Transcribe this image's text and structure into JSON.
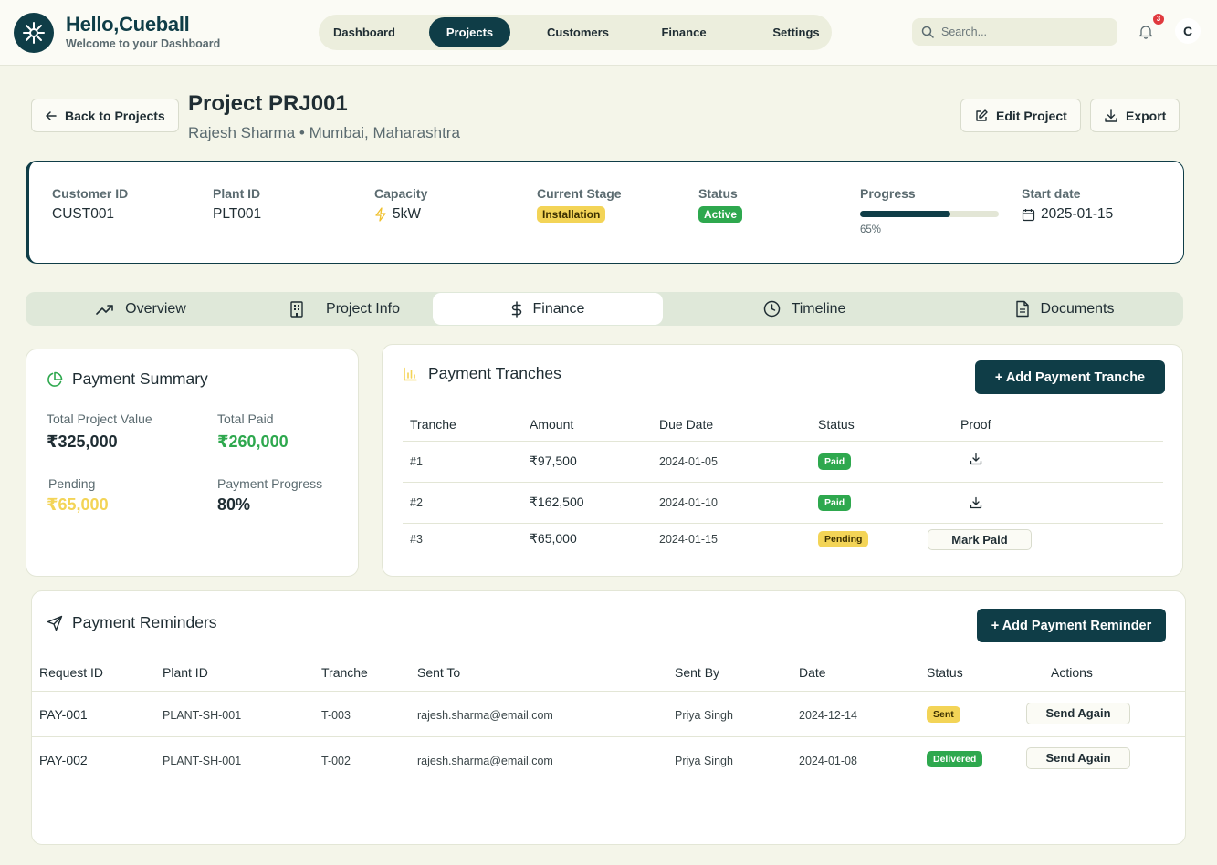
{
  "header": {
    "title": "Hello,Cueball",
    "subtitle": "Welcome to your Dashboard",
    "nav": [
      "Dashboard",
      "Projects",
      "Customers",
      "Finance",
      "Settings"
    ],
    "active_nav": "Projects",
    "search_placeholder": "Search...",
    "notification_count": "3",
    "avatar_initial": "C"
  },
  "project": {
    "back_label": "Back to Projects",
    "title": "Project PRJ001",
    "subtitle": "Rajesh Sharma • Mumbai, Maharashtra",
    "edit_label": "Edit Project",
    "export_label": "Export"
  },
  "info": {
    "customer_id_label": "Customer ID",
    "customer_id": "CUST001",
    "plant_id_label": "Plant ID",
    "plant_id": "PLT001",
    "capacity_label": "Capacity",
    "capacity": "5kW",
    "stage_label": "Current Stage",
    "stage": "Installation",
    "status_label": "Status",
    "status": "Active",
    "progress_label": "Progress",
    "progress_text": "65%",
    "progress_value": 0.65,
    "start_label": "Start date",
    "start_date": "2025-01-15"
  },
  "tabs": [
    "Overview",
    "Project Info",
    "Finance",
    "Timeline",
    "Documents"
  ],
  "active_tab": "Finance",
  "summary": {
    "title": "Payment Summary",
    "total_label": "Total Project Value",
    "total_value": "₹325,000",
    "paid_label": "Total Paid",
    "paid_value": "₹260,000",
    "pending_label": "Pending",
    "pending_value": "₹65,000",
    "progress_label": "Payment Progress",
    "progress_value": "80%"
  },
  "tranches": {
    "title": "Payment Tranches",
    "add_label": "+ Add Payment Tranche",
    "columns": [
      "Tranche",
      "Amount",
      "Due Date",
      "Status",
      "Proof"
    ],
    "rows": [
      {
        "id": "#1",
        "amount": "₹97,500",
        "due": "2024-01-05",
        "status": "Paid",
        "proof": "download"
      },
      {
        "id": "#2",
        "amount": "₹162,500",
        "due": "2024-01-10",
        "status": "Paid",
        "proof": "download"
      },
      {
        "id": "#3",
        "amount": "₹65,000",
        "due": "2024-01-15",
        "status": "Pending",
        "proof": "Mark Paid"
      }
    ]
  },
  "reminders": {
    "title": "Payment Reminders",
    "add_label": "+ Add Payment Reminder",
    "columns": [
      "Request ID",
      "Plant ID",
      "Tranche",
      "Sent To",
      "Sent By",
      "Date",
      "Status",
      "Actions"
    ],
    "rows": [
      {
        "request_id": "PAY-001",
        "plant_id": "PLANT-SH-001",
        "tranche": "T-003",
        "sent_to": "rajesh.sharma@email.com",
        "sent_by": "Priya Singh",
        "date": "2024-12-14",
        "status": "Sent",
        "action": "Send Again"
      },
      {
        "request_id": "PAY-002",
        "plant_id": "PLANT-SH-001",
        "tranche": "T-002",
        "sent_to": "rajesh.sharma@email.com",
        "sent_by": "Priya Singh",
        "date": "2024-01-08",
        "status": "Delivered",
        "action": "Send Again"
      }
    ]
  },
  "colors": {
    "primary": "#0f3d47",
    "paid_green": "#2ea84e",
    "pending_yellow": "#f3d457",
    "background": "#f4f5e9"
  }
}
